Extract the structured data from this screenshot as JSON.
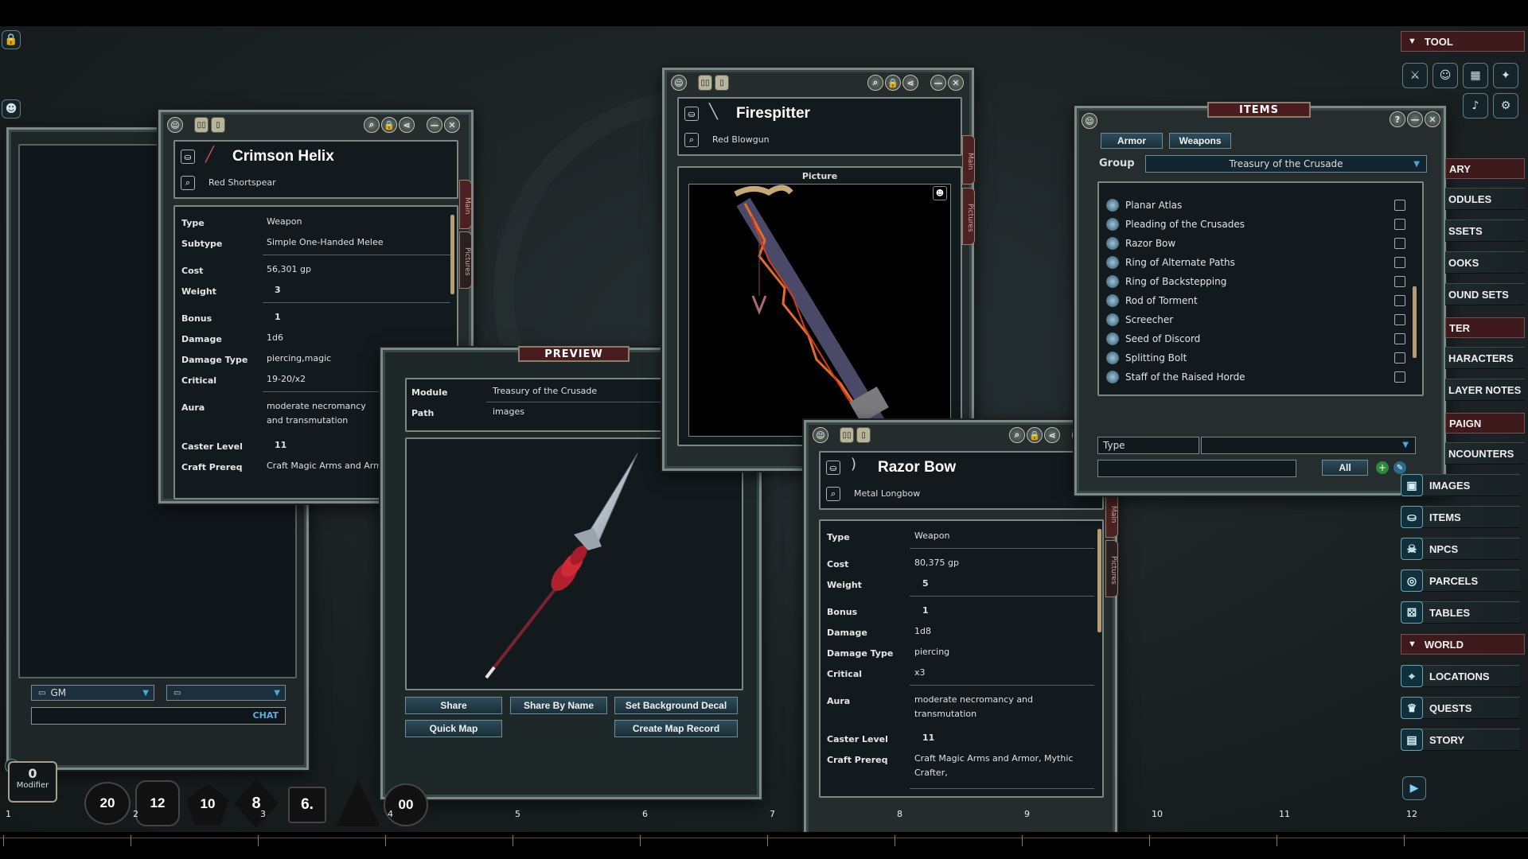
{
  "crimson": {
    "title": "Crimson Helix",
    "subtitle": "Red Shortspear",
    "tab_main": "Main",
    "tab_pictures": "Pictures",
    "fields": [
      {
        "label": "Type",
        "value": "Weapon"
      },
      {
        "label": "Subtype",
        "value": "Simple One-Handed Melee"
      },
      {
        "label": "Cost",
        "value": "56,301 gp"
      },
      {
        "label": "Weight",
        "value": "3"
      },
      {
        "label": "Bonus",
        "value": "1"
      },
      {
        "label": "Damage",
        "value": "1d6"
      },
      {
        "label": "Damage Type",
        "value": "piercing,magic"
      },
      {
        "label": "Critical",
        "value": "19-20/x2"
      },
      {
        "label": "Aura",
        "value": "moderate necromancy and transmutation"
      },
      {
        "label": "Caster Level",
        "value": "11"
      },
      {
        "label": "Craft Prereq",
        "value": "Craft Magic Arms and Armor"
      }
    ]
  },
  "chat": {
    "identity": "GM",
    "secondary": "",
    "send_label": "CHAT"
  },
  "modifier": {
    "value": "0",
    "label": "Modifier"
  },
  "dice": [
    "20",
    "12",
    "10",
    "8",
    "6.",
    "",
    "00"
  ],
  "preview": {
    "header": "PREVIEW",
    "module_label": "Module",
    "module_value": "Treasury of the Crusade",
    "path_label": "Path",
    "path_value": "images",
    "buttons": [
      "Share",
      "Share By Name",
      "Set Background Decal",
      "Quick Map",
      "Create Map Record"
    ]
  },
  "firespitter": {
    "title": "Firespitter",
    "subtitle": "Red Blowgun",
    "picture_label": "Picture",
    "tab_main": "Main",
    "tab_pictures": "Pictures"
  },
  "razor": {
    "title": "Razor Bow",
    "subtitle": "Metal Longbow",
    "tab_main": "Main",
    "tab_pictures": "Pictures",
    "fields": [
      {
        "label": "Type",
        "value": "Weapon"
      },
      {
        "label": "Cost",
        "value": "80,375 gp"
      },
      {
        "label": "Weight",
        "value": "5"
      },
      {
        "label": "Bonus",
        "value": "1"
      },
      {
        "label": "Damage",
        "value": "1d8"
      },
      {
        "label": "Damage Type",
        "value": "piercing"
      },
      {
        "label": "Critical",
        "value": "x3"
      },
      {
        "label": "Aura",
        "value": "moderate necromancy and transmutation"
      },
      {
        "label": "Caster Level",
        "value": "11"
      },
      {
        "label": "Craft Prereq",
        "value": "Craft Magic Arms and Armor, Mythic Crafter,"
      }
    ]
  },
  "items": {
    "header": "ITEMS",
    "filters": [
      "Armor",
      "Weapons"
    ],
    "group_label": "Group",
    "group_value": "Treasury of the Crusade",
    "list": [
      "Planar Atlas",
      "Pleading of the Crusades",
      "Razor Bow",
      "Ring of Alternate Paths",
      "Ring of Backstepping",
      "Rod of Torment",
      "Screecher",
      "Seed of Discord",
      "Splitting Bolt",
      "Staff of the Raised Horde"
    ],
    "type_label": "Type",
    "type_value": "",
    "all_button": "All"
  },
  "sidebar": {
    "tool_header": "TOOL",
    "library_tail": "ARY",
    "library_items": [
      "ODULES",
      "SSETS",
      "OOKS",
      "OUND SETS"
    ],
    "character_tail": "TER",
    "character_items": [
      "HARACTERS",
      "LAYER NOTES"
    ],
    "campaign_tail": "PAIGN",
    "campaign_items": [
      "NCOUNTERS",
      "IMAGES",
      "ITEMS",
      "NPCS",
      "PARCELS",
      "TABLES"
    ],
    "world_header": "WORLD",
    "world_items": [
      "LOCATIONS",
      "QUESTS",
      "STORY"
    ]
  },
  "hotkeys": [
    "1",
    "2",
    "3",
    "4",
    "5",
    "6",
    "7",
    "8",
    "9",
    "10",
    "11",
    "12"
  ],
  "colors": {
    "accent": "#4a1c1e",
    "panel": "#121a1d",
    "frame": "#7a8a86",
    "button": "#2d4c5a"
  }
}
